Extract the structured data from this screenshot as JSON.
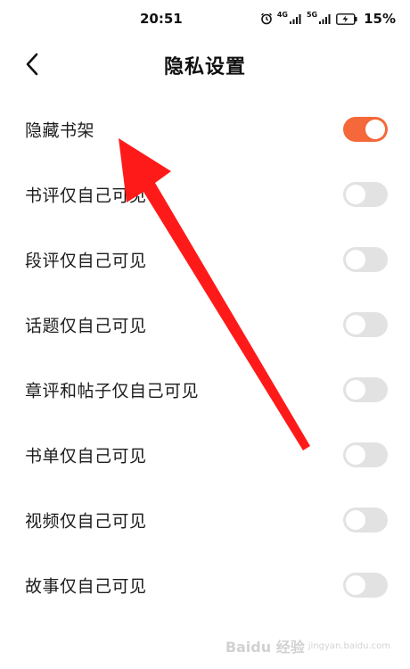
{
  "status_bar": {
    "time": "20:51",
    "network_1": "4G",
    "network_2": "5G",
    "battery_percent": "15%"
  },
  "header": {
    "title": "隐私设置",
    "back_icon": "chevron-left-icon"
  },
  "settings": [
    {
      "label": "隐藏书架",
      "enabled": true
    },
    {
      "label": "书评仅自己可见",
      "enabled": false
    },
    {
      "label": "段评仅自己可见",
      "enabled": false
    },
    {
      "label": "话题仅自己可见",
      "enabled": false
    },
    {
      "label": "章评和帖子仅自己可见",
      "enabled": false
    },
    {
      "label": "书单仅自己可见",
      "enabled": false
    },
    {
      "label": "视频仅自己可见",
      "enabled": false
    },
    {
      "label": "故事仅自己可见",
      "enabled": false
    }
  ],
  "colors": {
    "toggle_on": "#f4683a",
    "toggle_off": "#e2e2e2",
    "annotation_arrow": "#ff1a1a"
  },
  "watermark": {
    "text": "Baidu 经验",
    "sub": "jingyan.baidu.com"
  }
}
